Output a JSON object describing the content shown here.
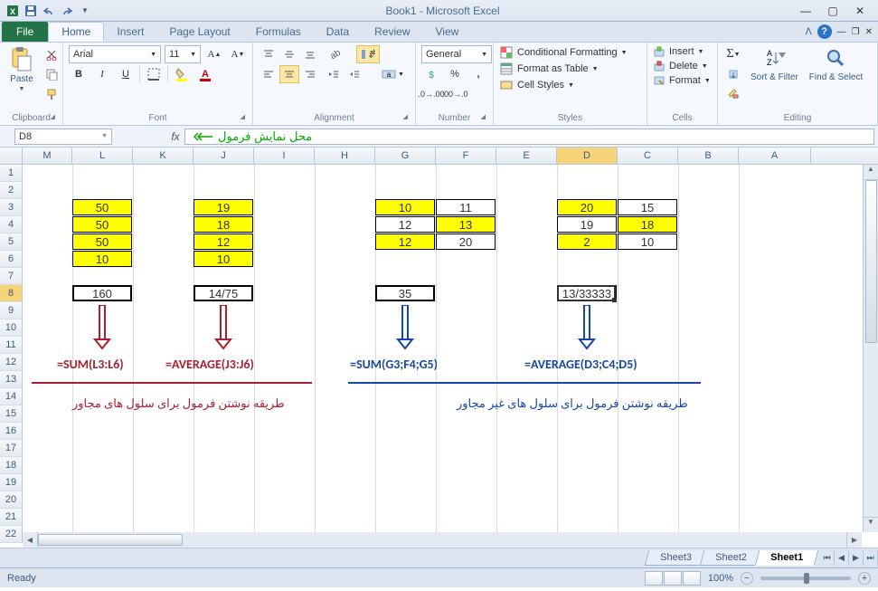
{
  "titlebar": {
    "title": "Book1 - Microsoft Excel"
  },
  "tabs": {
    "file": "File",
    "items": [
      "Home",
      "Insert",
      "Page Layout",
      "Formulas",
      "Data",
      "Review",
      "View"
    ],
    "active": 0
  },
  "ribbon": {
    "clipboard": {
      "label": "Clipboard",
      "paste": "Paste"
    },
    "font": {
      "label": "Font",
      "name": "Arial",
      "size": "11",
      "bold": "B",
      "italic": "I",
      "underline": "U"
    },
    "alignment": {
      "label": "Alignment"
    },
    "number": {
      "label": "Number",
      "format": "General"
    },
    "styles": {
      "label": "Styles",
      "cond": "Conditional Formatting",
      "table": "Format as Table",
      "cell": "Cell Styles"
    },
    "cells": {
      "label": "Cells",
      "insert": "Insert",
      "delete": "Delete",
      "format": "Format"
    },
    "editing": {
      "label": "Editing",
      "sort": "Sort & Filter",
      "find": "Find & Select"
    }
  },
  "formula_bar": {
    "name_box": "D8",
    "fx": "fx",
    "annotation": "محل نمایش فرمول"
  },
  "columns": [
    "M",
    "L",
    "K",
    "J",
    "I",
    "H",
    "G",
    "F",
    "E",
    "D",
    "C",
    "B",
    "A"
  ],
  "rows": [
    "1",
    "2",
    "3",
    "4",
    "5",
    "6",
    "7",
    "8",
    "9",
    "10",
    "11",
    "12",
    "13",
    "14",
    "15",
    "16",
    "17",
    "18",
    "19",
    "20",
    "21",
    "22"
  ],
  "selected_cell": {
    "col": 9,
    "row": 7
  },
  "grid": {
    "L": {
      "3": "50",
      "4": "50",
      "5": "50",
      "6": "10",
      "8": "160"
    },
    "J": {
      "3": "19",
      "4": "18",
      "5": "12",
      "6": "10",
      "8": "14/75"
    },
    "G": {
      "3": "10",
      "4": "12",
      "5": "12",
      "8": "35"
    },
    "F": {
      "3": "11",
      "4": "13",
      "5": "20"
    },
    "D": {
      "3": "20",
      "4": "19",
      "5": "2",
      "8": "13/33333"
    },
    "C": {
      "3": "15",
      "4": "18",
      "5": "10"
    }
  },
  "formulas": {
    "sum_l": "=SUM(L3:L6)",
    "avg_j": "=AVERAGE(J3:J6)",
    "sum_g": "=SUM(G3;F4;G5)",
    "avg_d": "=AVERAGE(D3;C4;D5)"
  },
  "captions": {
    "adjacent": "طریقه نوشتن فرمول برای سلول های مجاور",
    "nonadjacent": "طریقه نوشتن فرمول برای سلول های غیر مجاور"
  },
  "sheet_tabs": [
    "Sheet3",
    "Sheet2",
    "Sheet1"
  ],
  "active_sheet": 2,
  "status": {
    "ready": "Ready",
    "zoom": "100%"
  }
}
